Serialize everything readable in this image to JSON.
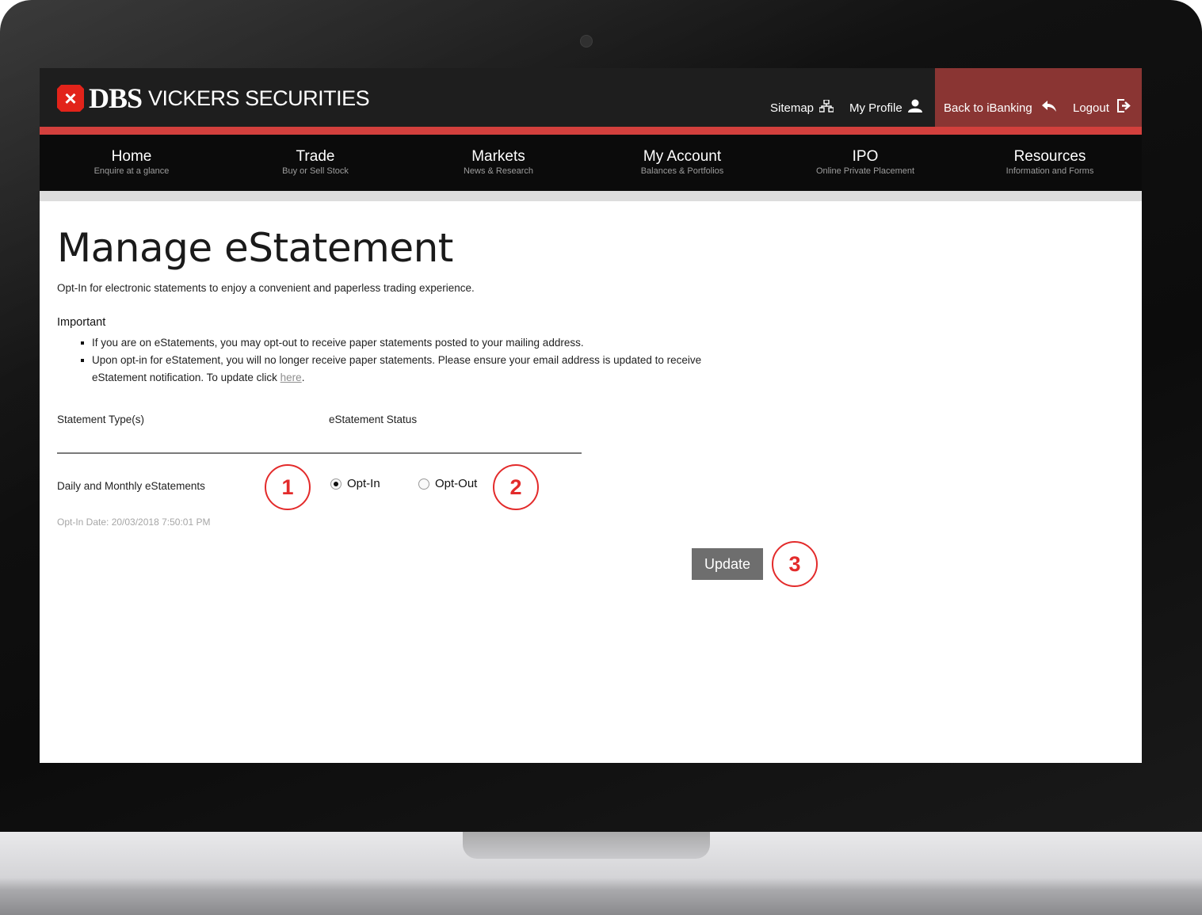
{
  "header": {
    "brand_dbs": "DBS",
    "brand_rest": "VICKERS SECURITIES",
    "sitemap_label": "Sitemap",
    "profile_label": "My Profile",
    "back_label": "Back to iBanking",
    "logout_label": "Logout"
  },
  "nav": {
    "items": [
      {
        "title": "Home",
        "sub": "Enquire at a glance"
      },
      {
        "title": "Trade",
        "sub": "Buy or Sell Stock"
      },
      {
        "title": "Markets",
        "sub": "News & Research"
      },
      {
        "title": "My Account",
        "sub": "Balances & Portfolios"
      },
      {
        "title": "IPO",
        "sub": "Online Private Placement"
      },
      {
        "title": "Resources",
        "sub": "Information and Forms"
      }
    ]
  },
  "page": {
    "title": "Manage eStatement",
    "intro": "Opt-In for electronic statements to enjoy a convenient and paperless trading experience.",
    "important_heading": "Important",
    "bullet1": "If you are on eStatements, you may opt-out to receive paper statements posted to your mailing address.",
    "bullet2_text": "Upon opt-in for eStatement, you will no longer receive paper statements. Please ensure your email address is updated to receive eStatement notification. To update click ",
    "bullet2_link": "here",
    "bullet2_end": "."
  },
  "table": {
    "col_type": "Statement Type(s)",
    "col_status": "eStatement Status",
    "row_label": "Daily and Monthly eStatements",
    "opt_in_label": "Opt-In",
    "opt_out_label": "Opt-Out",
    "selected": "Opt-In",
    "opt_in_date": "Opt-In Date: 20/03/2018 7:50:01 PM"
  },
  "update_label": "Update",
  "callouts": [
    "1",
    "2",
    "3"
  ],
  "colors": {
    "accent_red": "#d3403d",
    "back_box": "#8a3533",
    "callout_red": "#e32b2b"
  }
}
